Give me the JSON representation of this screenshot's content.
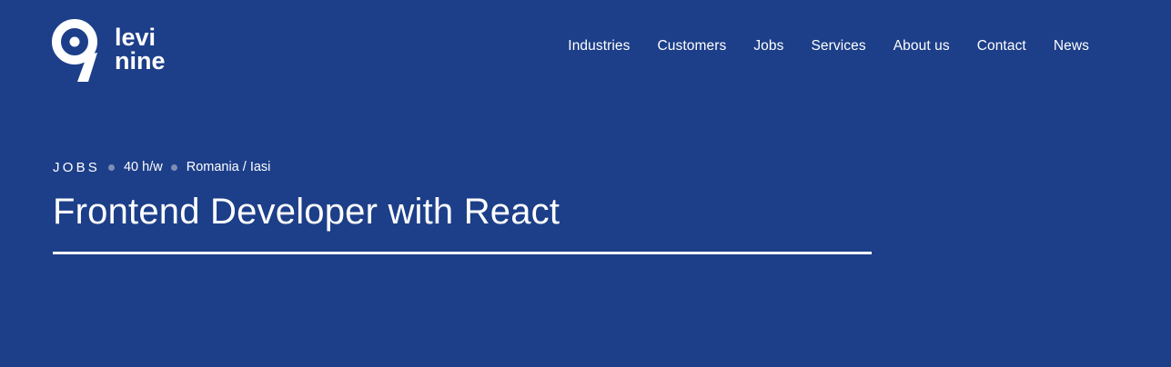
{
  "brand": {
    "logo_text_top": "levi",
    "logo_text_bottom": "nine",
    "logo_numeral": "9"
  },
  "nav": {
    "items": [
      {
        "label": "Industries"
      },
      {
        "label": "Customers"
      },
      {
        "label": "Jobs"
      },
      {
        "label": "Services"
      },
      {
        "label": "About us"
      },
      {
        "label": "Contact"
      },
      {
        "label": "News"
      }
    ]
  },
  "job": {
    "section": "JOBS",
    "hours": "40 h/w",
    "location": "Romania / Iasi",
    "title": "Frontend Developer with React"
  },
  "colors": {
    "background": "#1d3f89",
    "text": "#ffffff",
    "meta_dot": "#7f8fb4"
  }
}
